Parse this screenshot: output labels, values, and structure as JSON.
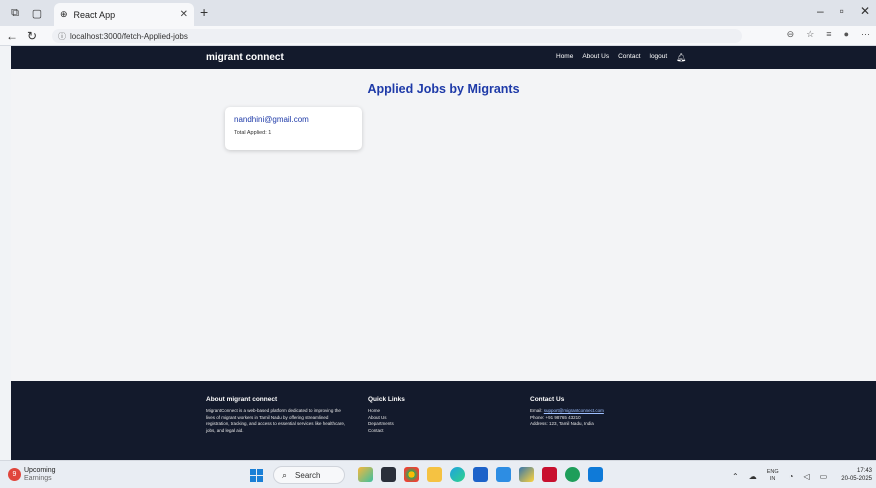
{
  "browser": {
    "tab_title": "React App",
    "url": "localhost:3000/fetch-Applied-jobs"
  },
  "navbar": {
    "brand": "migrant connect",
    "links": [
      "Home",
      "About Us",
      "Contact",
      "logout"
    ]
  },
  "main": {
    "heading": "Applied Jobs by Migrants",
    "cards": [
      {
        "email": "nandhini@gmail.com",
        "total": "Total Applied: 1"
      }
    ]
  },
  "footer": {
    "about": {
      "title": "About migrant connect",
      "text": "MigrantConnect is a web-based platform dedicated to improving the lives of migrant workers in Tamil Nadu by offering streamlined registration, tracking, and access to essential services like healthcare, jobs, and legal aid."
    },
    "quick_links": {
      "title": "Quick Links",
      "items": [
        "Home",
        "About Us",
        "Departments",
        "Contact"
      ]
    },
    "contact": {
      "title": "Contact Us",
      "email_label": "Email: ",
      "email": "support@migrantconnect.com",
      "phone": "Phone: +91 98765 43210",
      "address": "Address: 123, Tamil Nadu, India"
    }
  },
  "taskbar": {
    "weather_badge": "9",
    "weather_title": "Upcoming",
    "weather_sub": "Earnings",
    "search_label": "Search",
    "lang_top": "ENG",
    "lang_bottom": "IN",
    "time": "17:43",
    "date": "20-05-2025"
  },
  "colors": {
    "navbar_bg": "#131a2c",
    "heading": "#1e3aa8",
    "page_bg": "#f3f4f6"
  }
}
